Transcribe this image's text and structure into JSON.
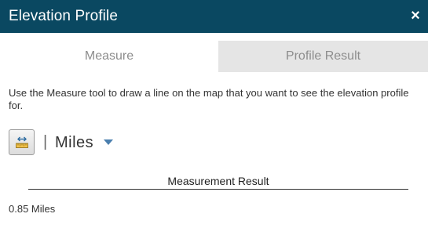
{
  "window": {
    "title": "Elevation Profile",
    "close_glyph": "×"
  },
  "tabs": [
    {
      "label": "Measure",
      "active": true
    },
    {
      "label": "Profile Result",
      "active": false
    }
  ],
  "measure": {
    "instructions": "Use the Measure tool to draw a line on the map that you want to see the elevation profile for.",
    "tool_icon": "ruler-measure-icon",
    "separator": "|",
    "unit": "Miles",
    "result_header": "Measurement Result",
    "result_value": "0.85 Miles"
  },
  "colors": {
    "titlebar": "#0a4861",
    "inactive_tab": "#e5e5e5",
    "caret": "#4a7fae"
  }
}
